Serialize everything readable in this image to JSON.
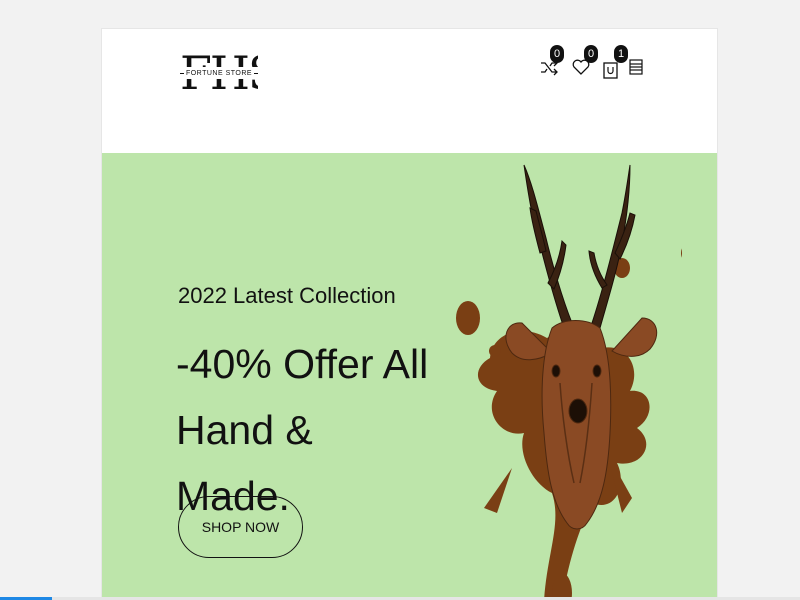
{
  "logo": {
    "letters": "FHS",
    "subtitle": "FORTUNE STORE"
  },
  "header_icons": [
    {
      "icon": "shuffle-icon",
      "label": "compare",
      "count": "0"
    },
    {
      "icon": "heart-icon",
      "label": "wishlist",
      "count": "0"
    },
    {
      "icon": "shopping-bag-icon",
      "label": "cart",
      "count": "1"
    },
    {
      "icon": "menu-icon",
      "label": "menu"
    }
  ],
  "hero": {
    "subtitle": "2022 Latest Collection",
    "title": "-40% Offer All Hand & Made.",
    "button_label": "SHOP NOW",
    "background_color": "#bde5aa",
    "image_alt": "carved wooden deer head with antlers on brown paint splash"
  },
  "colors": {
    "accent": "#111111",
    "splash": "#7a3f14",
    "scrollbar_thumb": "#1e88e5"
  }
}
